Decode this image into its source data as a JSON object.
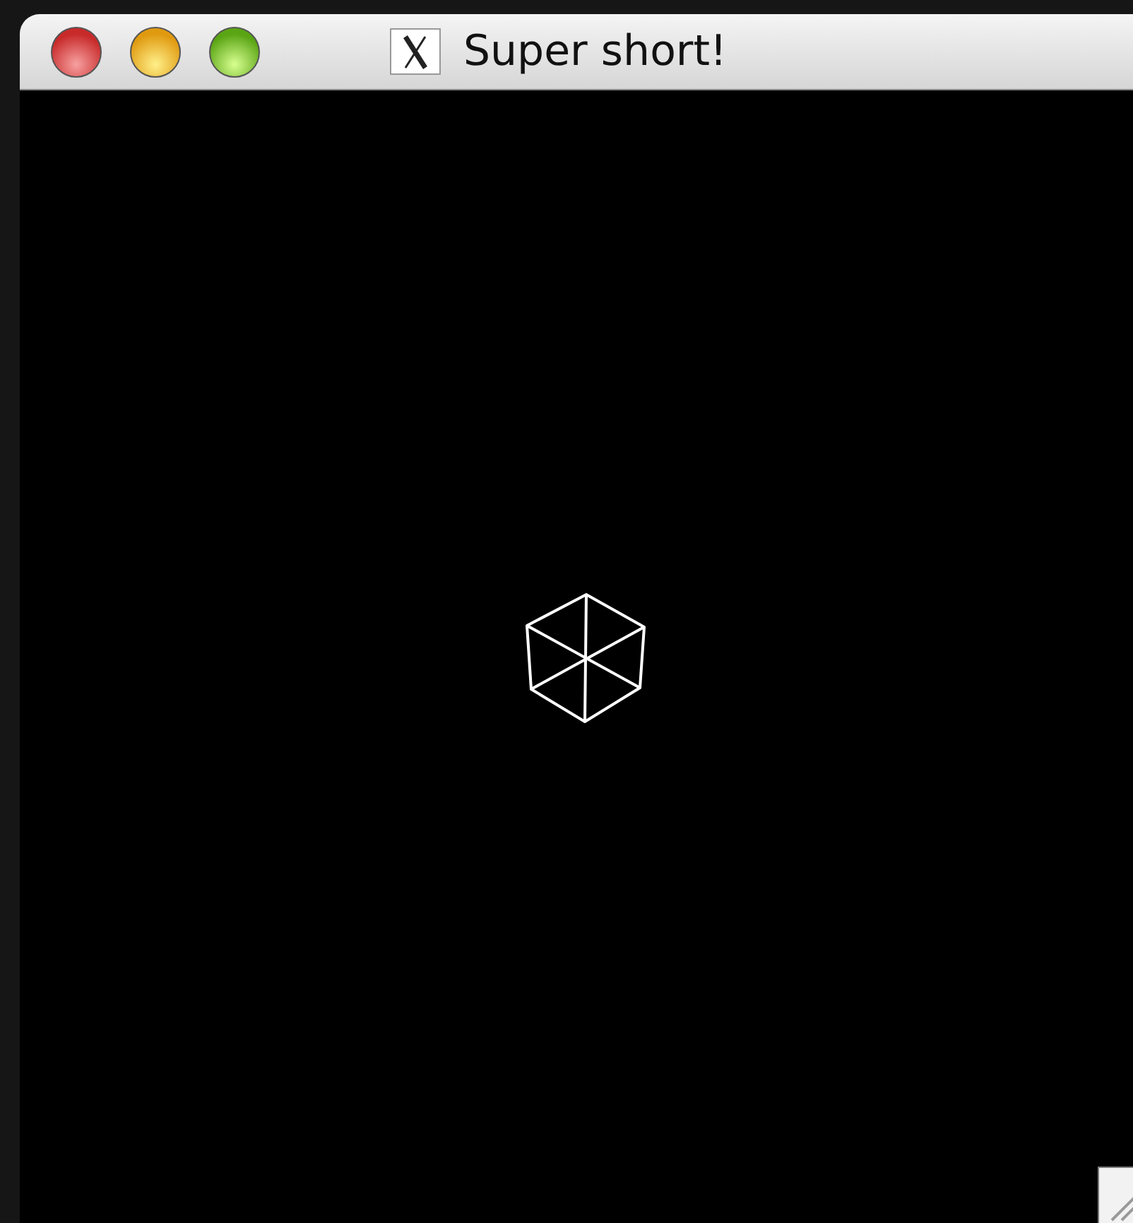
{
  "window": {
    "title": "Super short!"
  }
}
